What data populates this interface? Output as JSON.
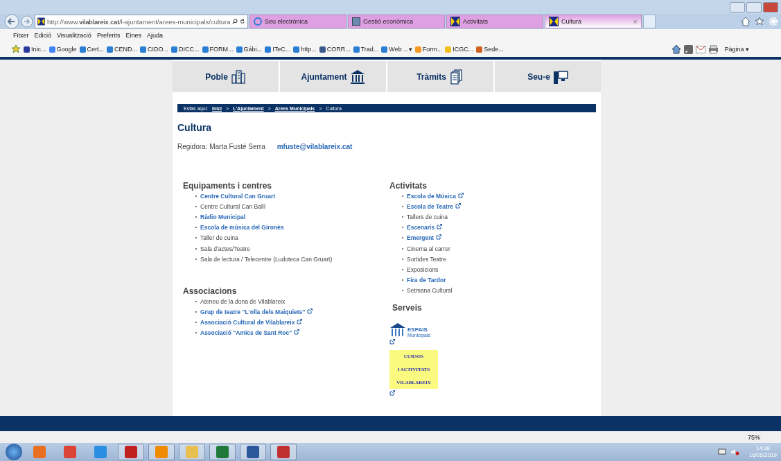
{
  "browser": {
    "address": "http://www.**vilablareix.cat**/l-ajuntament/arees-municipals/cultura",
    "tabs": [
      {
        "label": "Seu electrònica",
        "selected": false,
        "kind": "ie"
      },
      {
        "label": "Gestió econòmica",
        "selected": false,
        "kind": "doc"
      },
      {
        "label": "Activitats",
        "selected": false,
        "kind": "site"
      },
      {
        "label": "Cultura",
        "selected": true,
        "kind": "site",
        "close": "×"
      }
    ],
    "menu": [
      "Fitxer",
      "Edició",
      "Visualització",
      "Preferits",
      "Eines",
      "Ajuda"
    ],
    "favorites": [
      {
        "label": "Inic...",
        "kind": "blue"
      },
      {
        "label": "Google",
        "kind": "google"
      },
      {
        "label": "Cert...",
        "kind": "ie"
      },
      {
        "label": "CEND...",
        "kind": "ie"
      },
      {
        "label": "CIDO...",
        "kind": "ie"
      },
      {
        "label": "DICC...",
        "kind": "ie"
      },
      {
        "label": "FORM...",
        "kind": "ie"
      },
      {
        "label": "Gábi...",
        "kind": "ie"
      },
      {
        "label": "ITeC...",
        "kind": "ie"
      },
      {
        "label": "http...",
        "kind": "ie"
      },
      {
        "label": "CORR...",
        "kind": "gear"
      },
      {
        "label": "Trad...",
        "kind": "ie"
      },
      {
        "label": "Web ...",
        "kind": "ie",
        "dropdown": "▾"
      },
      {
        "label": "Form...",
        "kind": "orange"
      },
      {
        "label": "ICGC...",
        "kind": "yellow"
      },
      {
        "label": "Sede...",
        "kind": "grid"
      }
    ],
    "page_menu": "Pàgina ▾"
  },
  "page": {
    "nav": [
      {
        "label": "Poble",
        "kind": "buildings"
      },
      {
        "label": "Ajuntament",
        "kind": "columns"
      },
      {
        "label": "Tràmits",
        "kind": "documents"
      },
      {
        "label": "Seu-e",
        "kind": "computer"
      }
    ],
    "breadcrumb": {
      "label": "Estàs aquí:",
      "items": [
        {
          "label": "Inici",
          "link": true
        },
        {
          "label": "L'Ajuntament",
          "link": true
        },
        {
          "label": "Arees Municipals",
          "link": true
        },
        {
          "label": "Cultura",
          "link": false
        }
      ],
      "separator": ">"
    },
    "title": "Cultura",
    "councillor": "Regidora: Marta Fusté Serra",
    "email": "mfuste@vilablareix.cat",
    "left_sections": [
      {
        "title": "Equipaments i centres",
        "items": [
          {
            "label": "Centre Cultural Can Gruart",
            "link": true,
            "external": false
          },
          {
            "label": "Centre Cultural Can Ballí",
            "link": false,
            "external": false
          },
          {
            "label": "Ràdio Municipal",
            "link": true,
            "external": false
          },
          {
            "label": "Escola de música del Gironès",
            "link": true,
            "external": false
          },
          {
            "label": "Taller de cuina",
            "link": false,
            "external": false
          },
          {
            "label": "Sala d'actes/Teatre",
            "link": false,
            "external": false
          },
          {
            "label": "Sala de lectura / Telecentre (Ludoteca Can Gruart)",
            "link": false,
            "external": false
          }
        ]
      },
      {
        "title": "Associacions",
        "items": [
          {
            "label": "Ateneu de la dona de Vilablareix",
            "link": false,
            "external": false
          },
          {
            "label": "Grup de teatre \"L'olla dels Maiquiets\"",
            "link": true,
            "external": true
          },
          {
            "label": "Associació Cultural de Vilablareix",
            "link": true,
            "external": true
          },
          {
            "label": "Associació \"Amics de Sant Roc\"",
            "link": true,
            "external": true
          }
        ]
      }
    ],
    "activities": {
      "title": "Activitats",
      "items": [
        {
          "label": "Escola de Música",
          "link": true,
          "external": true
        },
        {
          "label": "Escola de Teatre",
          "link": true,
          "external": true
        },
        {
          "label": "Tallers de cuina",
          "link": false,
          "external": false
        },
        {
          "label": "Escenaris",
          "link": true,
          "external": true
        },
        {
          "label": "Emergent",
          "link": true,
          "external": true
        },
        {
          "label": "Cinema al carrer",
          "link": false,
          "external": false
        },
        {
          "label": "Sortides Teatre",
          "link": false,
          "external": false
        },
        {
          "label": "Exposicions",
          "link": false,
          "external": false
        },
        {
          "label": "Fira de Tardor",
          "link": true,
          "external": false
        },
        {
          "label": "Setmana Cultural",
          "link": false,
          "external": false
        }
      ]
    },
    "services": {
      "title": "Serveis",
      "banners": [
        {
          "kind": "espais",
          "lines": [
            "ESPAIS",
            "Municipals"
          ]
        },
        {
          "kind": "cursos",
          "lines": [
            "CURSOS",
            "I ACTIVITATS",
            "VILABLAREIX"
          ]
        }
      ]
    }
  },
  "status_bar": {
    "zoom": "75%"
  },
  "taskbar": {
    "time": "14:38",
    "date": "16/05/2019"
  }
}
